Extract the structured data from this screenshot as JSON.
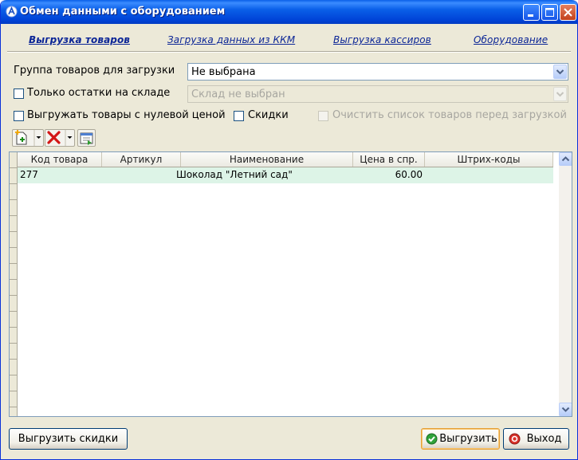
{
  "window": {
    "title": "Обмен данными с оборудованием"
  },
  "tabs": [
    {
      "label": "Выгрузка товаров"
    },
    {
      "label": "Загрузка данных из ККМ"
    },
    {
      "label": "Выгрузка кассиров"
    },
    {
      "label": "Оборудование"
    }
  ],
  "form": {
    "group_label": "Группа товаров для загрузки",
    "group_value": "Не выбрана",
    "stock_only_label": "Только остатки на складе",
    "warehouse_value": "Склад не выбран",
    "zero_price_label": "Выгружать товары с нулевой ценой",
    "discounts_label": "Скидки",
    "clear_list_label": "Очистить список товаров перед загрузкой"
  },
  "table": {
    "columns": [
      "Код товара",
      "Артикул",
      "Наименование",
      "Цена в спр.",
      "Штрих-коды"
    ],
    "rows": [
      {
        "code": "277",
        "article": "",
        "name": "Шоколад \"Летний сад\"",
        "price": "60.00",
        "barcodes": ""
      }
    ]
  },
  "buttons": {
    "upload_discounts": "Выгрузить скидки",
    "upload": "Выгрузить",
    "exit": "Выход"
  },
  "colors": {
    "titlebar": "#0a5fe8",
    "selected_row": "#ddf4e7",
    "link": "#0b2596"
  }
}
